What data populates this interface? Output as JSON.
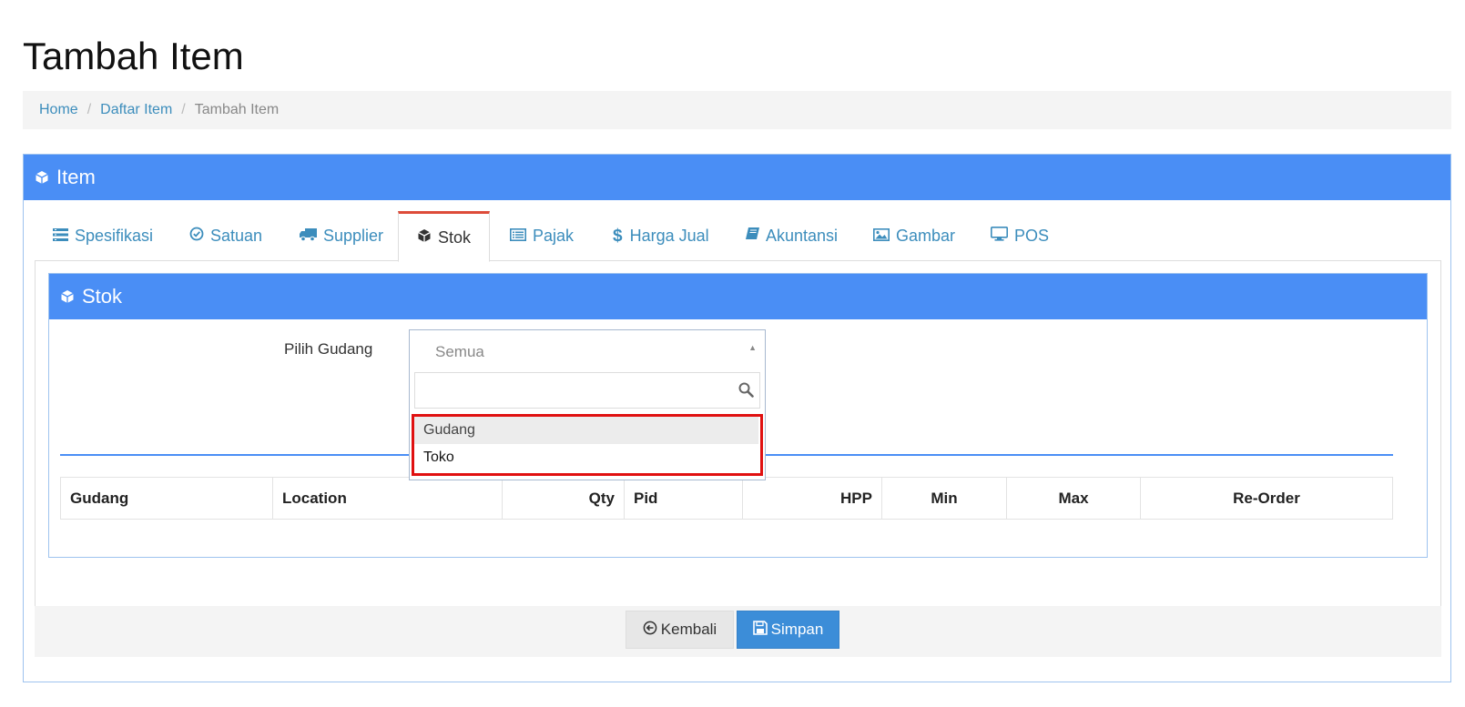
{
  "page": {
    "title": "Tambah Item"
  },
  "breadcrumb": {
    "items": [
      {
        "label": "Home"
      },
      {
        "label": "Daftar Item"
      }
    ],
    "active": "Tambah Item",
    "separator": "/"
  },
  "box": {
    "title": "Item",
    "header_color": "#4a8ef5"
  },
  "tabs": [
    {
      "label": "Spesifikasi",
      "icon": "list-icon"
    },
    {
      "label": "Satuan",
      "icon": "check-circle-icon"
    },
    {
      "label": "Supplier",
      "icon": "truck-icon"
    },
    {
      "label": "Stok",
      "icon": "cube-icon",
      "active": true
    },
    {
      "label": "Pajak",
      "icon": "list-alt-icon"
    },
    {
      "label": "Harga Jual",
      "icon": "dollar-icon"
    },
    {
      "label": "Akuntansi",
      "icon": "book-icon"
    },
    {
      "label": "Gambar",
      "icon": "image-icon"
    },
    {
      "label": "POS",
      "icon": "desktop-icon"
    }
  ],
  "stok": {
    "title": "Stok",
    "warehouse_label": "Pilih Gudang",
    "select": {
      "value": "Semua",
      "search_placeholder": "",
      "options": [
        "Gudang",
        "Toko"
      ]
    },
    "table": {
      "headers": [
        "Gudang",
        "Location",
        "Qty",
        "Pid",
        "HPP",
        "Min",
        "Max",
        "Re-Order"
      ],
      "rows": []
    }
  },
  "footer": {
    "back_label": "Kembali",
    "save_label": "Simpan"
  }
}
